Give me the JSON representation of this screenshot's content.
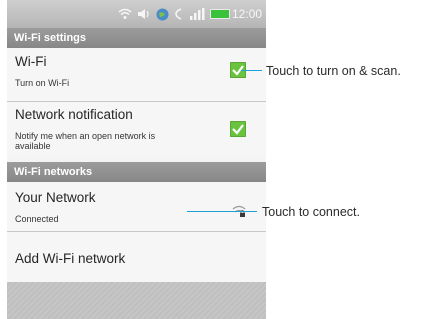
{
  "status_bar": {
    "time": "12:00",
    "icons": [
      "wifi-icon",
      "sound-icon",
      "globe-icon",
      "sync-icon",
      "signal-icon",
      "battery-icon"
    ]
  },
  "sections": {
    "wifi_settings": "Wi-Fi settings",
    "wifi_networks": "Wi-Fi networks"
  },
  "wifi": {
    "title": "Wi-Fi",
    "subtitle": "Turn on Wi-Fi",
    "checked": true
  },
  "network_notification": {
    "title": "Network notification",
    "subtitle_line1": "Notify me when an open network is",
    "subtitle_line2": "available",
    "checked": true
  },
  "your_network": {
    "title": "Your Network",
    "status": "Connected"
  },
  "add_network": {
    "title": "Add Wi-Fi network"
  },
  "callouts": {
    "scan": "Touch to turn on & scan.",
    "connect": "Touch to connect."
  },
  "colors": {
    "accent_line": "#1ba2d6",
    "checkbox": "#6ac33f",
    "header": "#8f8f8f"
  }
}
